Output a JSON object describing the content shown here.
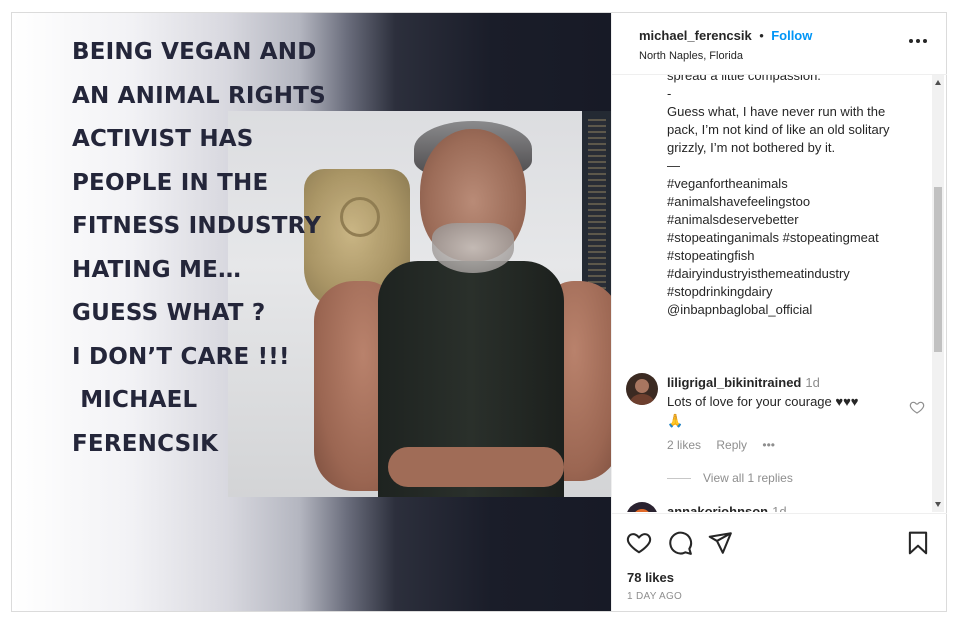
{
  "media": {
    "overlay_lines": [
      "BEING VEGAN AND",
      "AN ANIMAL RIGHTS",
      "ACTIVIST HAS",
      "PEOPLE IN THE",
      "FITNESS INDUSTRY",
      "HATING ME…",
      "GUESS WHAT ?",
      "I DON’T CARE !!!",
      " MICHAEL",
      "FERENCSIK"
    ]
  },
  "header": {
    "username": "michael_ferencsik",
    "separator": "•",
    "follow_label": "Follow",
    "location": "North Naples, Florida"
  },
  "caption": {
    "lines": [
      "spread a little compassion.",
      "-",
      "Guess what, I have never run with the",
      "pack, I’m not kind of like an old solitary",
      "grizzly, I’m not bothered by it.",
      "—",
      "#veganfortheanimals",
      "#animalshavefeelingstoo",
      "#animalsdeservebetter",
      "#stopeatinganimals #stopeatingmeat",
      "#stopeatingfish",
      "#dairyindustryisthemeatindustry",
      "#stopdrinkingdairy",
      "@inbapnbaglobal_official"
    ]
  },
  "comments": [
    {
      "username": "liligrigal_bikinitrained",
      "time": "1d",
      "text": "Lots of love for your courage ♥♥♥",
      "emoji": "🙏",
      "likes": "2 likes",
      "reply_label": "Reply",
      "more": "•••"
    },
    {
      "username": "annakorjohnson",
      "time": "1d"
    }
  ],
  "view_replies": "View all 1 replies",
  "footer": {
    "likes": "78 likes",
    "date": "1 DAY AGO"
  },
  "colors": {
    "link_blue": "#0095f6",
    "text": "#262626",
    "muted": "#8e8e8e"
  },
  "icons": [
    "heart-icon",
    "comment-icon",
    "share-icon",
    "bookmark-icon",
    "more-options-icon"
  ]
}
